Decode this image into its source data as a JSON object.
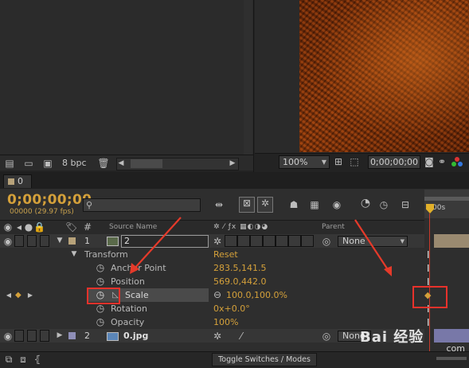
{
  "project": {
    "bpc": "8 bpc"
  },
  "viewer": {
    "zoom": "100%",
    "timecode": "0;00;00;00"
  },
  "comp_tab": {
    "label": "0"
  },
  "timeline": {
    "time": "0;00;00;00",
    "fps": "00000 (29.97 fps)",
    "search_placeholder": "",
    "headers": {
      "source_name": "Source Name",
      "parent": "Parent"
    },
    "time_ruler_label": "00s",
    "layers": [
      {
        "num": "1",
        "name": "2",
        "parent": "None"
      },
      {
        "num": "2",
        "name": "0.jpg",
        "parent": "None"
      }
    ],
    "transform": {
      "label": "Transform",
      "reset": "Reset",
      "props": [
        {
          "name": "Anchor Point",
          "value": "283.5,141.5"
        },
        {
          "name": "Position",
          "value": "569.0,442.0"
        },
        {
          "name": "Scale",
          "value": "100.0,100.0%"
        },
        {
          "name": "Rotation",
          "value": "0x+0.0°"
        },
        {
          "name": "Opacity",
          "value": "100%"
        }
      ]
    },
    "bottom_button": "Toggle Switches / Modes"
  },
  "watermark": {
    "text": "Bai 经验",
    "sub": "com"
  },
  "colors": {
    "accent": "#d4a03a",
    "highlight": "#e8322b"
  }
}
